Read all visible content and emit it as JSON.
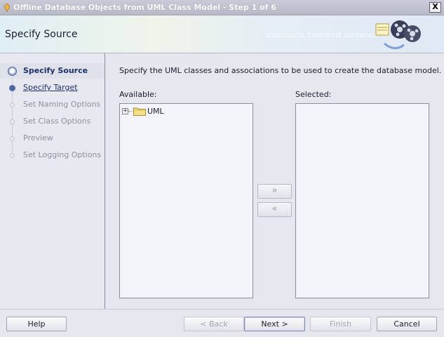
{
  "window": {
    "title": "Offline Database Objects from UML Class Model - Step 1 of 6",
    "close_label": "X"
  },
  "header": {
    "step_title": "Specify Source",
    "binary_text": "1010101010101 01010101010 01010101010"
  },
  "steps": [
    {
      "label": "Specify Source",
      "state": "current"
    },
    {
      "label": "Specify Target",
      "state": "link"
    },
    {
      "label": "Set Naming Options",
      "state": "disabled"
    },
    {
      "label": "Set Class Options",
      "state": "disabled"
    },
    {
      "label": "Preview",
      "state": "disabled"
    },
    {
      "label": "Set Logging Options",
      "state": "disabled"
    }
  ],
  "main": {
    "instructions": "Specify the UML classes and associations to be used to create the database model.",
    "available_label": "Available:",
    "selected_label": "Selected:",
    "tree": [
      {
        "label": "UML",
        "icon": "folder-icon",
        "expander": "+"
      }
    ],
    "move_right_glyph": "»",
    "move_left_glyph": "«"
  },
  "buttons": {
    "help": "Help",
    "back": "< Back",
    "next": "Next >",
    "finish": "Finish",
    "cancel": "Cancel"
  },
  "colors": {
    "accent": "#1d2f66",
    "disabled_text": "#8e90a0",
    "list_bg": "#f4f4fb"
  }
}
